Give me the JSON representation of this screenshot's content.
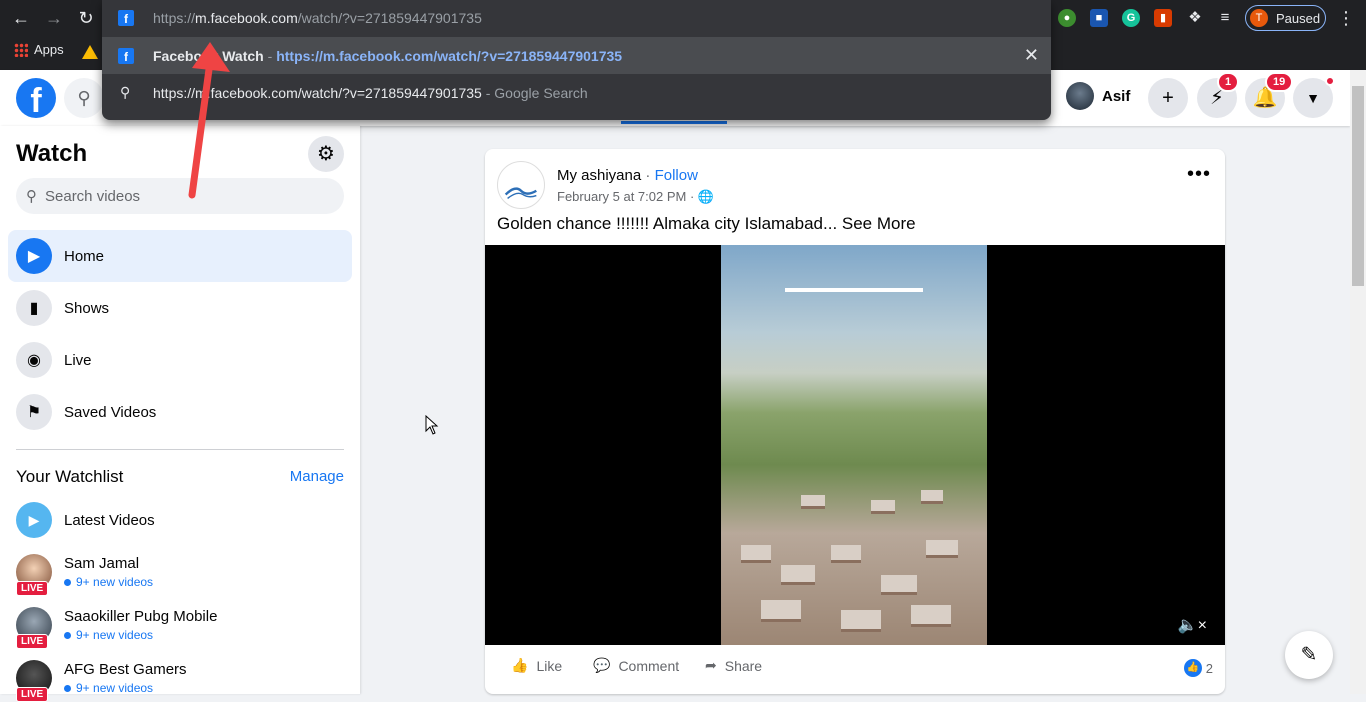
{
  "browser": {
    "apps_label": "Apps",
    "profile_initial": "T",
    "profile_label": "Paused",
    "omnibox": {
      "url_prefix": "https://",
      "url_host": "m.facebook.com",
      "url_path": "/watch/?v=271859447901735",
      "suggestion_title": "Facebook Watch",
      "suggestion_sep": " - ",
      "suggestion_url": "https://m.facebook.com/watch/?v=271859447901735",
      "search_query": "https://m.facebook.com/watch/?v=271859447901735",
      "search_suffix": " - Google Search"
    }
  },
  "header": {
    "user_name": "Asif",
    "messenger_badge": "1",
    "notifications_badge": "19"
  },
  "sidebar": {
    "title": "Watch",
    "search_placeholder": "Search videos",
    "items": [
      {
        "label": "Home"
      },
      {
        "label": "Shows"
      },
      {
        "label": "Live"
      },
      {
        "label": "Saved Videos"
      }
    ],
    "watchlist_title": "Your Watchlist",
    "manage_label": "Manage",
    "latest_label": "Latest Videos",
    "watchlist": [
      {
        "name": "Sam Jamal",
        "sub": "9+ new videos",
        "live": "LIVE"
      },
      {
        "name": "Saaokiller Pubg Mobile",
        "sub": "9+ new videos",
        "live": "LIVE"
      },
      {
        "name": "AFG Best Gamers",
        "sub": "9+ new videos",
        "live": "LIVE"
      }
    ]
  },
  "post": {
    "page_name": "My ashiyana",
    "dot": " · ",
    "follow": "Follow",
    "date": "February 5 at 7:02 PM · ",
    "text": "Golden chance !!!!!!! Almaka city Islamabad... See More",
    "like": "Like",
    "comment": "Comment",
    "share": "Share",
    "reaction_count": "2"
  },
  "colors": {
    "brand": "#1877f2",
    "badge": "#e41e3f",
    "chrome_bg": "#202124"
  }
}
